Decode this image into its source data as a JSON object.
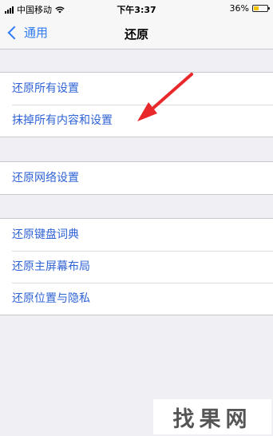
{
  "status_bar": {
    "carrier": "中国移动",
    "time": "下午3:37",
    "battery": "36%",
    "battery_level": 0.36,
    "icons": [
      "signal-icon",
      "wifi-icon",
      "battery-icon"
    ]
  },
  "nav": {
    "back_label": "通用",
    "title": "还原"
  },
  "groups": [
    {
      "items": [
        "还原所有设置",
        "抹掉所有内容和设置"
      ]
    },
    {
      "items": [
        "还原网络设置"
      ]
    },
    {
      "items": [
        "还原键盘词典",
        "还原主屏幕布局",
        "还原位置与隐私"
      ]
    }
  ],
  "annotation": {
    "type": "red-arrow",
    "points_to": "抹掉所有内容和设置",
    "color": "#e8282b"
  },
  "watermark": {
    "text": "找果网"
  },
  "colors": {
    "accent": "#2f7cf6",
    "row_text": "#2f63d6",
    "background": "#efeff4"
  }
}
